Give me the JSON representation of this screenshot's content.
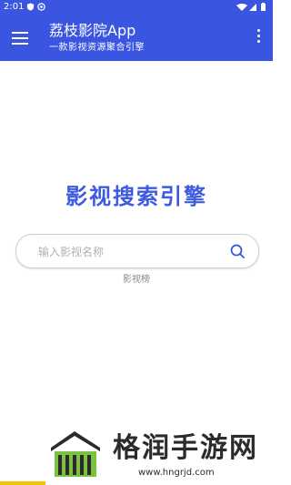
{
  "status_bar": {
    "time": "2:01",
    "background": "#3a56e0"
  },
  "app_bar": {
    "title": "荔枝影院App",
    "subtitle": "一款影视资源聚合引擎",
    "menu_icon": "hamburger-menu-icon",
    "more_icon": "more-vertical-icon"
  },
  "main": {
    "heading": "影视搜索引擎",
    "search": {
      "placeholder": "输入影视名称",
      "value": "",
      "icon": "search-icon"
    },
    "rank_link": "影视榜"
  },
  "watermark": {
    "name": "格润手游网",
    "url": "www.hngrjd.com"
  },
  "colors": {
    "primary": "#3a56e0",
    "heading": "#3d5be0",
    "accent_bar": "#f0c400"
  }
}
